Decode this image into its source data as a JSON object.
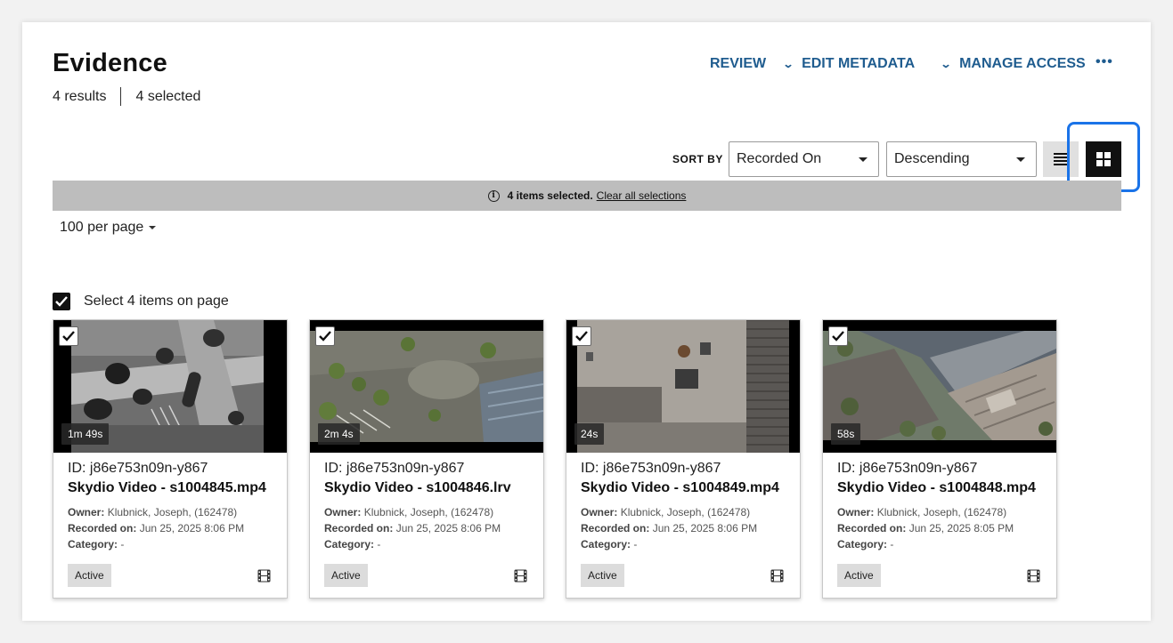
{
  "page": {
    "title": "Evidence",
    "results": "4 results",
    "selected": "4 selected"
  },
  "actions": {
    "review": "REVIEW",
    "edit_metadata": "EDIT METADATA",
    "manage_access": "MANAGE ACCESS",
    "more": "•••"
  },
  "sort": {
    "label": "SORT BY",
    "field": "Recorded On",
    "order": "Descending"
  },
  "banner": {
    "text": "4 items selected.",
    "link": "Clear all selections"
  },
  "pagination": {
    "per_page": "100 per page"
  },
  "select_all": {
    "label": "Select 4 items on page",
    "checked": true
  },
  "labels": {
    "owner": "Owner:",
    "recorded": "Recorded on:",
    "category": "Category:"
  },
  "cards": [
    {
      "duration": "1m 49s",
      "id": "ID: j86e753n09n-y867",
      "name": "Skydio Video - s1004845.mp4",
      "owner": "Klubnick, Joseph, (162478)",
      "recorded": "Jun 25, 2025 8:06 PM",
      "category": "-",
      "status": "Active",
      "thumb": "thermal"
    },
    {
      "duration": "2m 4s",
      "id": "ID: j86e753n09n-y867",
      "name": "Skydio Video - s1004846.lrv",
      "owner": "Klubnick, Joseph, (162478)",
      "recorded": "Jun 25, 2025 8:06 PM",
      "category": "-",
      "status": "Active",
      "thumb": "parking"
    },
    {
      "duration": "24s",
      "id": "ID: j86e753n09n-y867",
      "name": "Skydio Video - s1004849.mp4",
      "owner": "Klubnick, Joseph, (162478)",
      "recorded": "Jun 25, 2025 8:06 PM",
      "category": "-",
      "status": "Active",
      "thumb": "rooftop"
    },
    {
      "duration": "58s",
      "id": "ID: j86e753n09n-y867",
      "name": "Skydio Video - s1004848.mp4",
      "owner": "Klubnick, Joseph, (162478)",
      "recorded": "Jun 25, 2025 8:05 PM",
      "category": "-",
      "status": "Active",
      "thumb": "building"
    }
  ],
  "colors": {
    "accent": "#1f5c8f",
    "highlight": "#1a73e8",
    "banner": "#bdbdbd"
  }
}
